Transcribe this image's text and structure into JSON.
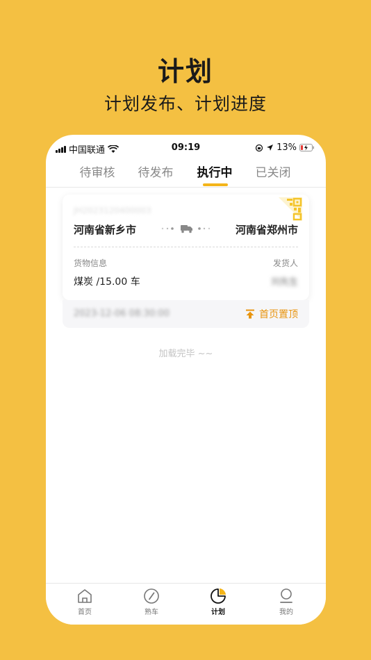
{
  "hero": {
    "title": "计划",
    "subtitle": "计划发布、计划进度"
  },
  "statusbar": {
    "carrier": "中国联通",
    "time": "09:19",
    "battery": "13%"
  },
  "tabs": [
    {
      "label": "待审核",
      "active": false
    },
    {
      "label": "待发布",
      "active": false
    },
    {
      "label": "执行中",
      "active": true
    },
    {
      "label": "已关闭",
      "active": false
    }
  ],
  "plan_card": {
    "plan_no": "JH2023120400003",
    "from": "河南省新乡市",
    "to": "河南省郑州市",
    "goods_label": "货物信息",
    "goods_value": "煤炭 /15.00 车",
    "shipper_label": "发货人",
    "shipper_value": "刘先生",
    "time": "2023-12-06 08:30:00",
    "pin_label": "首页置顶"
  },
  "list_end_text": "加载完毕 ~~",
  "bottom_nav": [
    {
      "label": "首页",
      "icon": "home-icon",
      "active": false
    },
    {
      "label": "熟车",
      "icon": "compass-icon",
      "active": false
    },
    {
      "label": "计划",
      "icon": "pie-chart-icon",
      "active": true
    },
    {
      "label": "我的",
      "icon": "user-icon",
      "active": false
    }
  ],
  "colors": {
    "background": "#F4C042",
    "accent": "#F4B51A",
    "pin": "#E8940F"
  }
}
